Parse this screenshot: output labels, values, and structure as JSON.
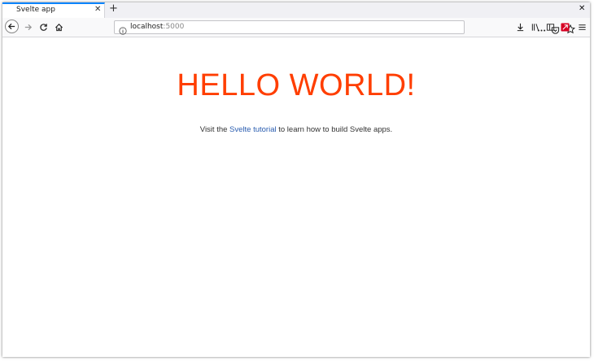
{
  "browser": {
    "tab": {
      "title": "Svelte app"
    },
    "url": {
      "host": "localhost",
      "port": ":5000"
    }
  },
  "page": {
    "heading": "HELLO WORLD!",
    "tagline": {
      "prefix": "Visit the ",
      "link": "Svelte tutorial",
      "suffix": " to learn how to build Svelte apps."
    }
  },
  "colors": {
    "heading": "#ff3e00",
    "link": "#2a5db0",
    "tab_accent": "#0a84ff"
  },
  "icons": [
    "back-icon",
    "forward-icon",
    "reload-icon",
    "home-icon",
    "info-icon",
    "page-actions-icon",
    "pocket-icon",
    "star-icon",
    "download-icon",
    "library-icon",
    "sidebar-icon",
    "extension-icon",
    "menu-icon"
  ]
}
